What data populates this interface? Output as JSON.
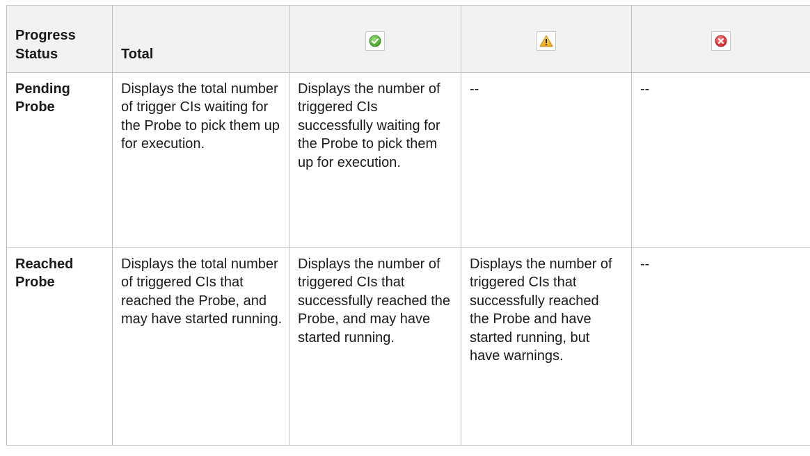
{
  "table": {
    "headers": {
      "status": "Progress Status",
      "total": "Total"
    },
    "header_icons": [
      "success-icon",
      "warning-icon",
      "error-icon"
    ],
    "colors": {
      "success": "#4caf2e",
      "warning": "#f1b71a",
      "error": "#d9262e",
      "header_bg": "#f2f2f2",
      "border": "#bfbfbf"
    },
    "rows": [
      {
        "status": "Pending Probe",
        "total": "Displays the total number of trigger CIs waiting for the Probe to pick them up for execution.",
        "success": "Displays the number of triggered CIs successfully waiting for the Probe to pick them up for execution.",
        "warning": "--",
        "error": "--"
      },
      {
        "status": "Reached Probe",
        "total": "Displays the total number of triggered CIs that reached the Probe, and may have started running.",
        "success": "Displays the number of triggered CIs that successfully reached the Probe, and may have started running.",
        "warning": "Displays the number of triggered CIs that successfully reached the Probe and have started running, but have warnings.",
        "error": "--"
      }
    ]
  }
}
